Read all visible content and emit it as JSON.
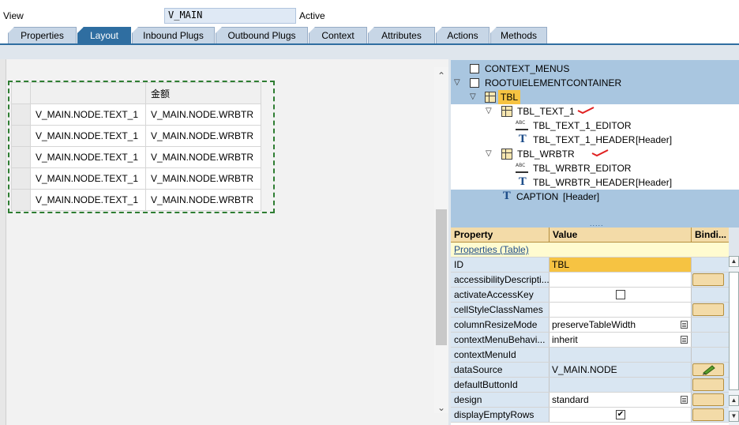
{
  "header": {
    "view_label": "View",
    "view_value": "V_MAIN",
    "status": "Active"
  },
  "tabs": [
    {
      "label": "Properties",
      "active": false
    },
    {
      "label": "Layout",
      "active": true
    },
    {
      "label": "Inbound Plugs",
      "active": false
    },
    {
      "label": "Outbound Plugs",
      "active": false
    },
    {
      "label": "Context",
      "active": false
    },
    {
      "label": "Attributes",
      "active": false
    },
    {
      "label": "Actions",
      "active": false
    },
    {
      "label": "Methods",
      "active": false
    }
  ],
  "layout_table": {
    "header": [
      "",
      "金额"
    ],
    "rows": [
      [
        "V_MAIN.NODE.TEXT_1",
        "V_MAIN.NODE.WRBTR"
      ],
      [
        "V_MAIN.NODE.TEXT_1",
        "V_MAIN.NODE.WRBTR"
      ],
      [
        "V_MAIN.NODE.TEXT_1",
        "V_MAIN.NODE.WRBTR"
      ],
      [
        "V_MAIN.NODE.TEXT_1",
        "V_MAIN.NODE.WRBTR"
      ],
      [
        "V_MAIN.NODE.TEXT_1",
        "V_MAIN.NODE.WRBTR"
      ]
    ]
  },
  "tree": [
    {
      "label": "CONTEXT_MENUS",
      "suffix": "",
      "icon": "checkbox-icon"
    },
    {
      "label": "ROOTUIELEMENTCONTAINER",
      "suffix": "",
      "icon": "checkbox-icon"
    },
    {
      "label": "TBL",
      "suffix": "",
      "icon": "table-icon"
    },
    {
      "label": "TBL_TEXT_1",
      "suffix": "",
      "icon": "table-column-icon"
    },
    {
      "label": "TBL_TEXT_1_EDITOR",
      "suffix": "",
      "icon": "input-field-icon"
    },
    {
      "label": "TBL_TEXT_1_HEADER",
      "suffix": "[Header]",
      "icon": "text-view-icon"
    },
    {
      "label": "TBL_WRBTR",
      "suffix": "",
      "icon": "table-column-icon"
    },
    {
      "label": "TBL_WRBTR_EDITOR",
      "suffix": "",
      "icon": "input-field-icon"
    },
    {
      "label": "TBL_WRBTR_HEADER",
      "suffix": "[Header]",
      "icon": "text-view-icon"
    },
    {
      "label": "CAPTION",
      "suffix": "[Header]",
      "icon": "text-view-icon"
    }
  ],
  "splitter": {
    "dots": "....."
  },
  "properties": {
    "headers": {
      "property": "Property",
      "value": "Value",
      "binding": "Bindi..."
    },
    "section": "Properties (Table)",
    "rows": [
      {
        "name": "ID",
        "value": "TBL"
      },
      {
        "name": "accessibilityDescripti...",
        "value": ""
      },
      {
        "name": "activateAccessKey",
        "value": ""
      },
      {
        "name": "cellStyleClassNames",
        "value": ""
      },
      {
        "name": "columnResizeMode",
        "value": "preserveTableWidth"
      },
      {
        "name": "contextMenuBehavi...",
        "value": "inherit"
      },
      {
        "name": "contextMenuId",
        "value": ""
      },
      {
        "name": "dataSource",
        "value": "V_MAIN.NODE"
      },
      {
        "name": "defaultButtonId",
        "value": ""
      },
      {
        "name": "design",
        "value": "standard"
      },
      {
        "name": "displayEmptyRows",
        "value": ""
      }
    ]
  },
  "scroll_glyphs": {
    "up": "⌃",
    "down": "⌄",
    "up_small": "▲",
    "down_small": "▼"
  },
  "colors": {
    "tab_active": "#2f6ea1",
    "tab_inactive": "#c7d6e6",
    "tree_bg": "#a9c6e0",
    "highlight": "#f6c342",
    "selection_dashed": "#2e7d32",
    "property_header": "#f3dba8"
  }
}
